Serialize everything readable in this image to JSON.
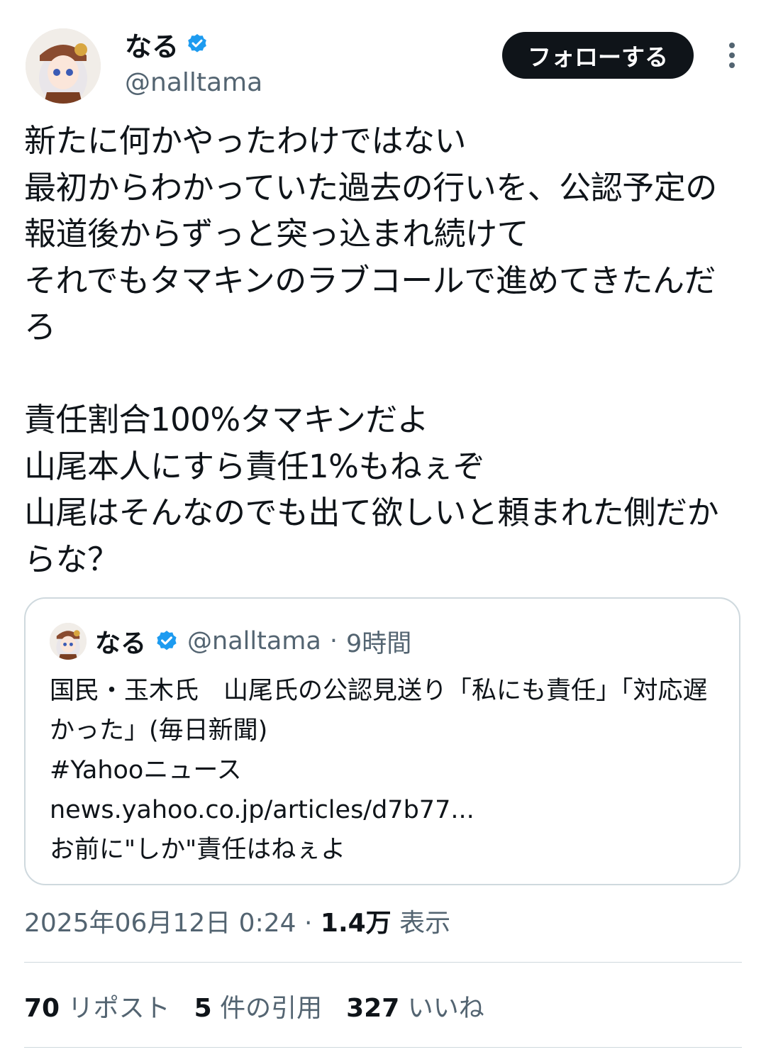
{
  "author": {
    "name": "なる",
    "handle": "@nalltama"
  },
  "follow_label": "フォローする",
  "tweet_text": "新たに何かやったわけではない\n最初からわかっていた過去の行いを、公認予定の報道後からずっと突っ込まれ続けて\nそれでもタマキンのラブコールで進めてきたんだろ\n\n責任割合100%タマキンだよ\n山尾本人にすら責任1%もねぇぞ\n山尾はそんなのでも出て欲しいと頼まれた側だからな？",
  "quote": {
    "name": "なる",
    "handle": "@nalltama",
    "separator": "·",
    "time": "9時間",
    "text": "国民・玉木氏　山尾氏の公認見送り「私にも責任」「対応遅かった」(毎日新聞)\n#Yahooニュース\nnews.yahoo.co.jp/articles/d7b77...\nお前に\"しか\"責任はねぇよ"
  },
  "meta": {
    "datetime": "2025年06月12日 0:24",
    "separator": "·",
    "views_count": "1.4万",
    "views_label": "表示"
  },
  "stats": {
    "reposts_count": "70",
    "reposts_label": "リポスト",
    "quotes_count": "5",
    "quotes_label": "件の引用",
    "likes_count": "327",
    "likes_label": "いいね"
  },
  "colors": {
    "verified": "#1d9bf0",
    "text": "#0f1419",
    "secondary": "#536471",
    "border": "#cfd9de"
  }
}
